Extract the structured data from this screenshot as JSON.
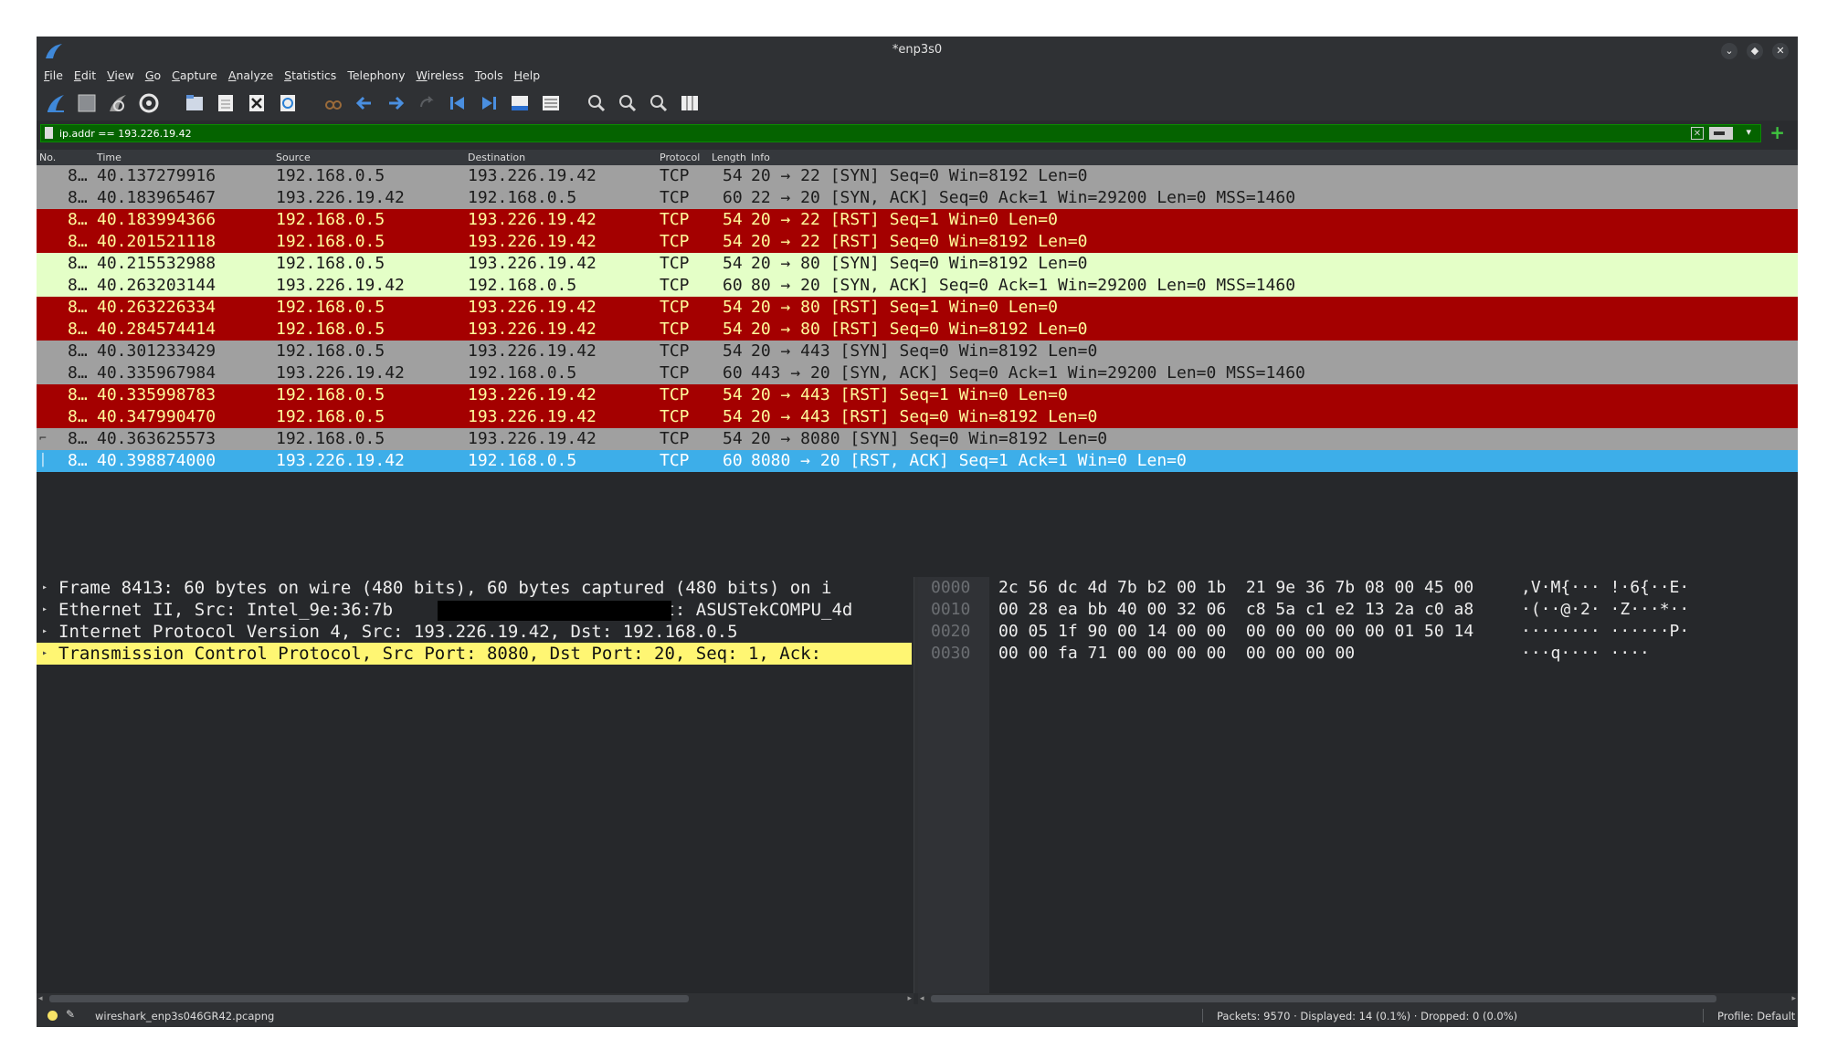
{
  "window": {
    "title": "*enp3s0"
  },
  "menu": [
    {
      "u": "F",
      "rest": "ile"
    },
    {
      "u": "E",
      "rest": "dit"
    },
    {
      "u": "V",
      "rest": "iew"
    },
    {
      "u": "G",
      "rest": "o"
    },
    {
      "u": "C",
      "rest": "apture"
    },
    {
      "u": "A",
      "rest": "nalyze"
    },
    {
      "u": "S",
      "rest": "tatistics"
    },
    {
      "u": "",
      "rest": "Telephony"
    },
    {
      "u": "W",
      "rest": "ireless"
    },
    {
      "u": "T",
      "rest": "ools"
    },
    {
      "u": "H",
      "rest": "elp"
    }
  ],
  "filter": {
    "value": "ip.addr == 193.226.19.42",
    "color": "#056300"
  },
  "columns": {
    "no": "No.",
    "time": "Time",
    "source": "Source",
    "destination": "Destination",
    "protocol": "Protocol",
    "length": "Length",
    "info": "Info"
  },
  "packets": [
    {
      "no": "8…",
      "time": "40.137279916",
      "src": "192.168.0.5",
      "dst": "193.226.19.42",
      "proto": "TCP",
      "len": "54",
      "info": "20 → 22 [SYN] Seq=0 Win=8192 Len=0",
      "color": "gray"
    },
    {
      "no": "8…",
      "time": "40.183965467",
      "src": "193.226.19.42",
      "dst": "192.168.0.5",
      "proto": "TCP",
      "len": "60",
      "info": "22 → 20 [SYN, ACK] Seq=0 Ack=1 Win=29200 Len=0 MSS=1460",
      "color": "gray"
    },
    {
      "no": "8…",
      "time": "40.183994366",
      "src": "192.168.0.5",
      "dst": "193.226.19.42",
      "proto": "TCP",
      "len": "54",
      "info": "20 → 22 [RST] Seq=1 Win=0 Len=0",
      "color": "red"
    },
    {
      "no": "8…",
      "time": "40.201521118",
      "src": "192.168.0.5",
      "dst": "193.226.19.42",
      "proto": "TCP",
      "len": "54",
      "info": "20 → 22 [RST] Seq=0 Win=8192 Len=0",
      "color": "red"
    },
    {
      "no": "8…",
      "time": "40.215532988",
      "src": "192.168.0.5",
      "dst": "193.226.19.42",
      "proto": "TCP",
      "len": "54",
      "info": "20 → 80 [SYN] Seq=0 Win=8192 Len=0",
      "color": "lightgreen"
    },
    {
      "no": "8…",
      "time": "40.263203144",
      "src": "193.226.19.42",
      "dst": "192.168.0.5",
      "proto": "TCP",
      "len": "60",
      "info": "80 → 20 [SYN, ACK] Seq=0 Ack=1 Win=29200 Len=0 MSS=1460",
      "color": "lightgreen"
    },
    {
      "no": "8…",
      "time": "40.263226334",
      "src": "192.168.0.5",
      "dst": "193.226.19.42",
      "proto": "TCP",
      "len": "54",
      "info": "20 → 80 [RST] Seq=1 Win=0 Len=0",
      "color": "red"
    },
    {
      "no": "8…",
      "time": "40.284574414",
      "src": "192.168.0.5",
      "dst": "193.226.19.42",
      "proto": "TCP",
      "len": "54",
      "info": "20 → 80 [RST] Seq=0 Win=8192 Len=0",
      "color": "red"
    },
    {
      "no": "8…",
      "time": "40.301233429",
      "src": "192.168.0.5",
      "dst": "193.226.19.42",
      "proto": "TCP",
      "len": "54",
      "info": "20 → 443 [SYN] Seq=0 Win=8192 Len=0",
      "color": "gray"
    },
    {
      "no": "8…",
      "time": "40.335967984",
      "src": "193.226.19.42",
      "dst": "192.168.0.5",
      "proto": "TCP",
      "len": "60",
      "info": "443 → 20 [SYN, ACK] Seq=0 Ack=1 Win=29200 Len=0 MSS=1460",
      "color": "gray"
    },
    {
      "no": "8…",
      "time": "40.335998783",
      "src": "192.168.0.5",
      "dst": "193.226.19.42",
      "proto": "TCP",
      "len": "54",
      "info": "20 → 443 [RST] Seq=1 Win=0 Len=0",
      "color": "red"
    },
    {
      "no": "8…",
      "time": "40.347990470",
      "src": "192.168.0.5",
      "dst": "193.226.19.42",
      "proto": "TCP",
      "len": "54",
      "info": "20 → 443 [RST] Seq=0 Win=8192 Len=0",
      "color": "red"
    },
    {
      "no": "8…",
      "time": "40.363625573",
      "src": "192.168.0.5",
      "dst": "193.226.19.42",
      "proto": "TCP",
      "len": "54",
      "info": "20 → 8080 [SYN] Seq=0 Win=8192 Len=0",
      "color": "gray"
    },
    {
      "no": "8…",
      "time": "40.398874000",
      "src": "193.226.19.42",
      "dst": "192.168.0.5",
      "proto": "TCP",
      "len": "60",
      "info": "8080 → 20 [RST, ACK] Seq=1 Ack=1 Win=0 Len=0",
      "color": "selected"
    }
  ],
  "details": [
    {
      "text": "Frame 8413: 60 bytes on wire (480 bits), 60 bytes captured (480 bits) on i",
      "highlight": false
    },
    {
      "text": "Ethernet II, Src: Intel_9e:36:7b                        Dst: ASUSTekCOMPU_4d",
      "highlight": false
    },
    {
      "text": "Internet Protocol Version 4, Src: 193.226.19.42, Dst: 192.168.0.5",
      "highlight": false
    },
    {
      "text": "Transmission Control Protocol, Src Port: 8080, Dst Port: 20, Seq: 1, Ack:",
      "highlight": true
    }
  ],
  "bytes": [
    {
      "off": "0000",
      "hex": "2c 56 dc 4d 7b b2 00 1b  21 9e 36 7b 08 00 45 00",
      "ascii": ",V·M{··· !·6{··E·"
    },
    {
      "off": "0010",
      "hex": "00 28 ea bb 40 00 32 06  c8 5a c1 e2 13 2a c0 a8",
      "ascii": "·(··@·2· ·Z···*··"
    },
    {
      "off": "0020",
      "hex": "00 05 1f 90 00 14 00 00  00 00 00 00 00 01 50 14",
      "ascii": "········ ······P·"
    },
    {
      "off": "0030",
      "hex": "00 00 fa 71 00 00 00 00  00 00 00 00",
      "ascii": "···q···· ····"
    }
  ],
  "status": {
    "file": "wireshark_enp3s046GR42.pcapng",
    "packets": "Packets: 9570 · Displayed: 14 (0.1%) · Dropped: 0 (0.0%)",
    "profile": "Profile: Default"
  },
  "icons": [
    "shark-fin-icon",
    "stop-icon",
    "restart-icon",
    "capture-options-icon",
    "open-file-icon",
    "save-file-icon",
    "close-file-icon",
    "reload-icon",
    "find-packet-icon",
    "go-back-icon",
    "go-forward-icon",
    "go-to-packet-icon",
    "first-packet-icon",
    "last-packet-icon",
    "autoscroll-icon",
    "colorize-icon",
    "zoom-in-icon",
    "zoom-out-icon",
    "normal-size-icon",
    "resize-columns-icon"
  ]
}
